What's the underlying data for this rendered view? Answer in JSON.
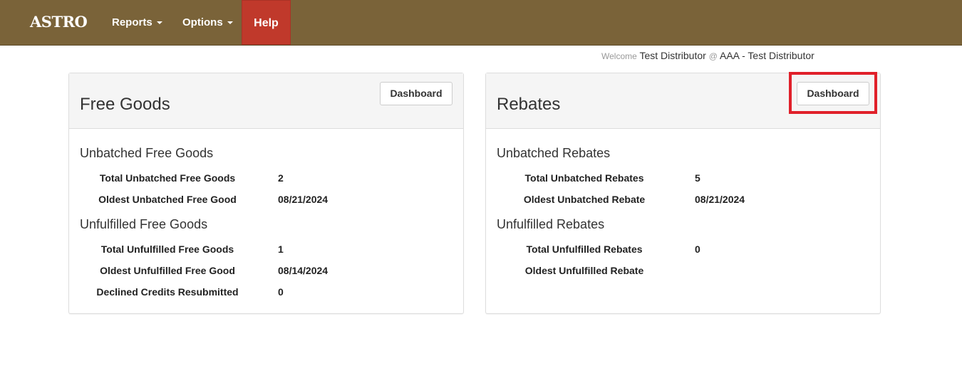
{
  "nav": {
    "brand": "ASTRO",
    "reports": "Reports",
    "options": "Options",
    "help": "Help"
  },
  "welcome": {
    "prefix": "Welcome",
    "user": "Test Distributor",
    "at": "@",
    "org": "AAA - Test Distributor"
  },
  "free_goods": {
    "title": "Free Goods",
    "dashboard_label": "Dashboard",
    "unbatched_title": "Unbatched Free Goods",
    "unbatched_rows": [
      {
        "label": "Total Unbatched Free Goods",
        "value": "2"
      },
      {
        "label": "Oldest Unbatched Free Good",
        "value": "08/21/2024"
      }
    ],
    "unfulfilled_title": "Unfulfilled Free Goods",
    "unfulfilled_rows": [
      {
        "label": "Total Unfulfilled Free Goods",
        "value": "1"
      },
      {
        "label": "Oldest Unfulfilled Free Good",
        "value": "08/14/2024"
      },
      {
        "label": "Declined Credits Resubmitted",
        "value": "0"
      }
    ]
  },
  "rebates": {
    "title": "Rebates",
    "dashboard_label": "Dashboard",
    "unbatched_title": "Unbatched Rebates",
    "unbatched_rows": [
      {
        "label": "Total Unbatched Rebates",
        "value": "5"
      },
      {
        "label": "Oldest Unbatched Rebate",
        "value": "08/21/2024"
      }
    ],
    "unfulfilled_title": "Unfulfilled Rebates",
    "unfulfilled_rows": [
      {
        "label": "Total Unfulfilled Rebates",
        "value": "0"
      },
      {
        "label": "Oldest Unfulfilled Rebate",
        "value": ""
      }
    ]
  },
  "colors": {
    "navbar": "#7a6339",
    "help_button": "#c0392b",
    "highlight": "#e0202a"
  }
}
